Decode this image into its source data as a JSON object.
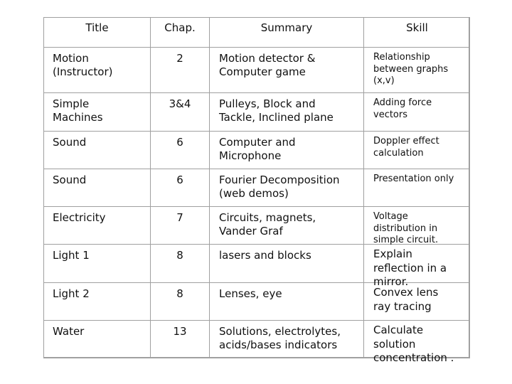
{
  "table": {
    "headers": [
      "Title",
      "Chap.",
      "Summary",
      "Skill"
    ],
    "rows": [
      {
        "title": [
          "Motion",
          "(Instructor)"
        ],
        "chapter": "2",
        "summary": [
          "Motion detector &",
          "Computer game"
        ],
        "skill": [
          "Relationship",
          "between graphs",
          "(x,v)"
        ],
        "skill_size": "small"
      },
      {
        "title": [
          "Simple",
          "Machines"
        ],
        "chapter": "3&4",
        "summary": [
          "Pulleys, Block and",
          "Tackle, Inclined plane"
        ],
        "skill": [
          "Adding force",
          "vectors"
        ],
        "skill_size": "small"
      },
      {
        "title": [
          "Sound"
        ],
        "chapter": "6",
        "summary": [
          "Computer and",
          "Microphone"
        ],
        "skill": [
          "Doppler effect",
          "calculation"
        ],
        "skill_size": "small"
      },
      {
        "title": [
          "Sound"
        ],
        "chapter": "6",
        "summary": [
          "Fourier Decomposition",
          "(web demos)"
        ],
        "skill": [
          "Presentation only"
        ],
        "skill_size": "small"
      },
      {
        "title": [
          "Electricity"
        ],
        "chapter": "7",
        "summary": [
          "Circuits, magnets,",
          "Vander Graf"
        ],
        "skill": [
          "Voltage",
          "distribution in",
          "simple circuit."
        ],
        "skill_size": "small"
      },
      {
        "title": [
          "Light 1"
        ],
        "chapter": "8",
        "summary": [
          "lasers and blocks"
        ],
        "skill": [
          "Explain",
          "reflection in a",
          "mirror."
        ],
        "skill_size": "large"
      },
      {
        "title": [
          "Light 2"
        ],
        "chapter": "8",
        "summary": [
          "Lenses, eye"
        ],
        "skill": [
          "Convex lens",
          "ray tracing"
        ],
        "skill_size": "large"
      },
      {
        "title": [
          "Water"
        ],
        "chapter": "13",
        "summary": [
          "Solutions, electrolytes,",
          "acids/bases indicators"
        ],
        "skill": [
          "Calculate",
          "solution",
          "concentration ."
        ],
        "skill_size": "large"
      }
    ]
  }
}
